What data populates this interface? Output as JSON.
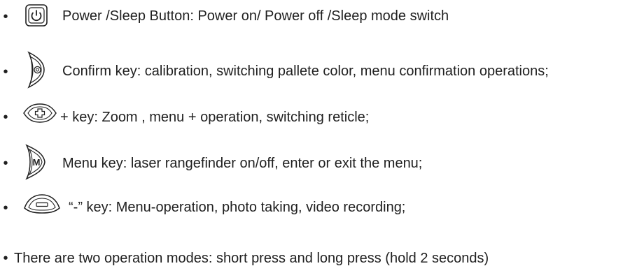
{
  "bullet": "•",
  "items": [
    {
      "icon": "power-button-icon",
      "text": "Power /Sleep Button: Power on/ Power off /Sleep mode switch"
    },
    {
      "icon": "confirm-key-icon",
      "text": "Confirm key: calibration, switching pallete color, menu confirmation operations;"
    },
    {
      "icon": "plus-key-icon",
      "text": "+ key: Zoom , menu + operation, switching reticle;"
    },
    {
      "icon": "menu-key-icon",
      "text": "Menu key: laser rangefinder on/off, enter or exit the menu;"
    },
    {
      "icon": "minus-key-icon",
      "text": "“-”  key: Menu-operation, photo taking, video recording;"
    }
  ],
  "note": "There are two operation modes: short press and long press (hold 2 seconds)"
}
